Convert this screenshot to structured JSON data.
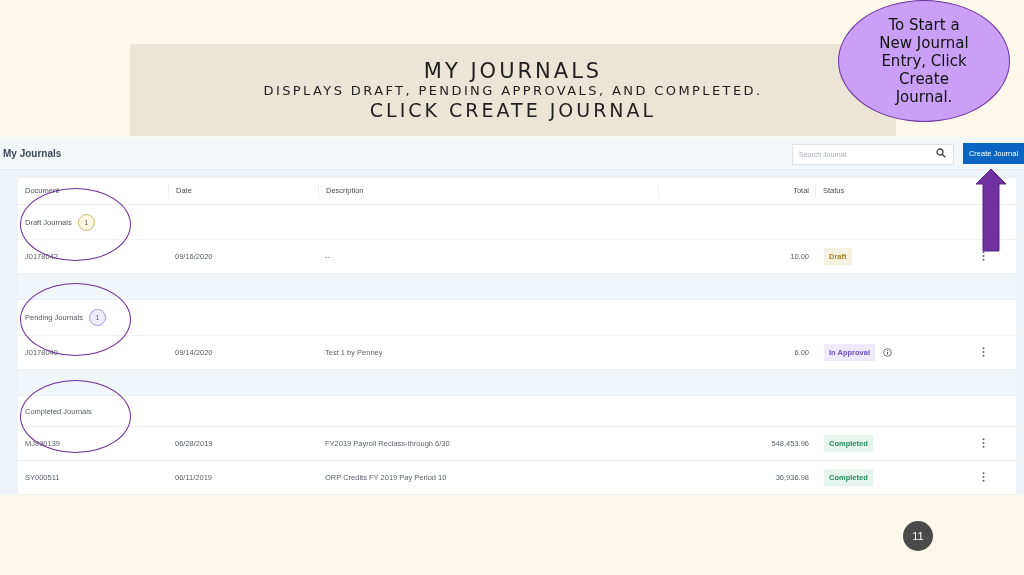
{
  "banner": {
    "title": "MY JOURNALS",
    "subtitle": "DISPLAYS DRAFT, PENDING APPROVALS, AND COMPLETED.",
    "instruction": "CLICK CREATE JOURNAL"
  },
  "callout": {
    "text": "To Start a New Journal Entry, Click Create Journal.",
    "arrow": true
  },
  "app": {
    "title": "My Journals",
    "search": {
      "placeholder": "Search Journal"
    },
    "create_button": "Create Journal",
    "columns": [
      "Document",
      "Date",
      "Description",
      "Total",
      "Status"
    ],
    "groups": [
      {
        "label": "Draft Journals",
        "count": "1",
        "kind": "draft",
        "circled": true,
        "rows": [
          {
            "document": "J0178042",
            "date": "09/16/2020",
            "description": "--",
            "total": "10.00",
            "status": "Draft",
            "kind": "draft",
            "info": false
          }
        ]
      },
      {
        "label": "Pending Journals",
        "count": "1",
        "kind": "pending",
        "circled": true,
        "rows": [
          {
            "document": "J0178040",
            "date": "09/14/2020",
            "description": "Test 1 by Penney",
            "total": "6.00",
            "status": "In Approval",
            "kind": "approval",
            "info": true
          }
        ]
      },
      {
        "label": "Completed Journals",
        "circled": true,
        "rows": [
          {
            "document": "MJ890139",
            "date": "06/28/2019",
            "description": "FY2019 Payroll Reclass-through 6/30",
            "total": "548,453.96",
            "status": "Completed",
            "kind": "completed",
            "info": false
          },
          {
            "document": "SY000511",
            "date": "06/11/2019",
            "description": "ORP Credits FY 2019 Pay Period 10",
            "total": "36,936.98",
            "status": "Completed",
            "kind": "completed",
            "info": false
          }
        ]
      }
    ]
  },
  "page_number": "11"
}
